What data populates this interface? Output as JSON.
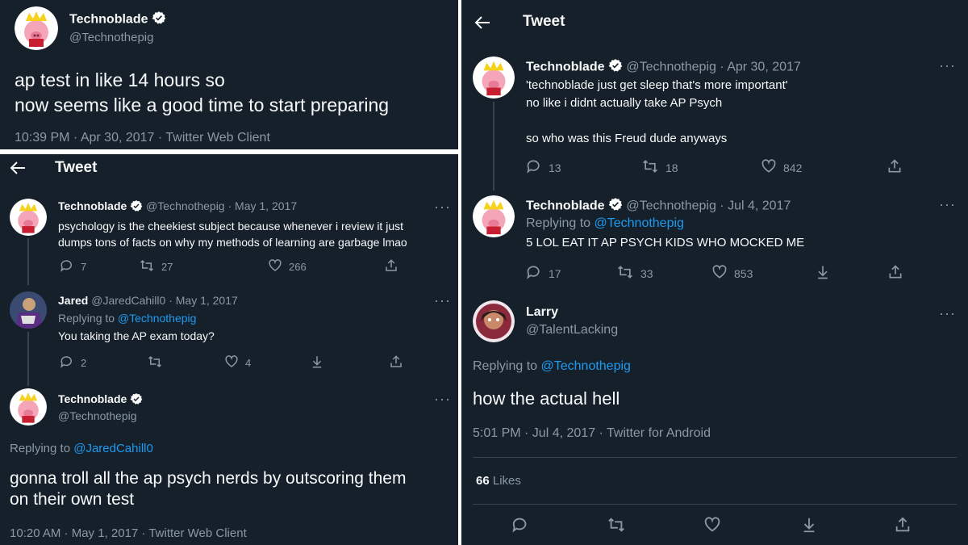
{
  "colors": {
    "background": "#15202b",
    "text": "#f7f9f9",
    "muted": "#8b98a5",
    "link": "#1d9bf0",
    "verified": "#ffffff"
  },
  "panel1": {
    "name": "Technoblade",
    "handle": "@Technothepig",
    "text_line1": "ap test in like 14 hours so",
    "text_line2": "now seems like a good time to start preparing",
    "meta": "10:39 PM · Apr 30, 2017 · Twitter Web Client"
  },
  "panel2": {
    "header": "Tweet",
    "tweet1": {
      "name": "Technoblade",
      "handle": "@Technothepig",
      "date": "· May 1, 2017",
      "text_line1": "psychology is the cheekiest subject because whenever i review it just",
      "text_line2": "dumps tons of facts on why my methods of learning are garbage lmao",
      "replies": "7",
      "retweets": "27",
      "likes": "266"
    },
    "tweet2": {
      "name": "Jared",
      "handle": "@JaredCahill0",
      "date": "· May 1, 2017",
      "replying_prefix": "Replying to",
      "replying_to": "@Technothepig",
      "text": "You taking the AP exam today?",
      "replies": "2",
      "likes": "4"
    },
    "tweet3": {
      "name": "Technoblade",
      "handle": "@Technothepig",
      "replying_prefix": "Replying to",
      "replying_to": "@JaredCahill0",
      "text_line1": "gonna troll all the ap psych nerds by outscoring them",
      "text_line2": "on their own test",
      "meta": "10:20 AM · May 1, 2017 · Twitter Web Client"
    }
  },
  "panel3": {
    "header": "Tweet",
    "tweet1": {
      "name": "Technoblade",
      "handle": "@Technothepig",
      "date": "· Apr 30, 2017",
      "text_line1": "'technoblade just get sleep that's more important'",
      "text_line2": "no like i didnt actually take AP Psych",
      "text_line3": "so who was this Freud dude anyways",
      "replies": "13",
      "retweets": "18",
      "likes": "842"
    },
    "tweet2": {
      "name": "Technoblade",
      "handle": "@Technothepig",
      "date": "· Jul 4, 2017",
      "replying_prefix": "Replying to",
      "replying_to": "@Technothepig",
      "text": "5 LOL EAT IT AP PSYCH KIDS WHO MOCKED ME",
      "replies": "17",
      "retweets": "33",
      "likes": "853"
    },
    "tweet3": {
      "name": "Larry",
      "handle": "@TalentLacking",
      "replying_prefix": "Replying to",
      "replying_to": "@Technothepig",
      "text": "how the actual hell",
      "meta": "5:01 PM · Jul 4, 2017 · Twitter for Android",
      "likes_count": "66",
      "likes_label": "Likes"
    }
  },
  "icons": [
    "back-arrow-icon",
    "verified-badge-icon",
    "more-icon",
    "reply-icon",
    "retweet-icon",
    "like-icon",
    "download-icon",
    "share-icon"
  ]
}
